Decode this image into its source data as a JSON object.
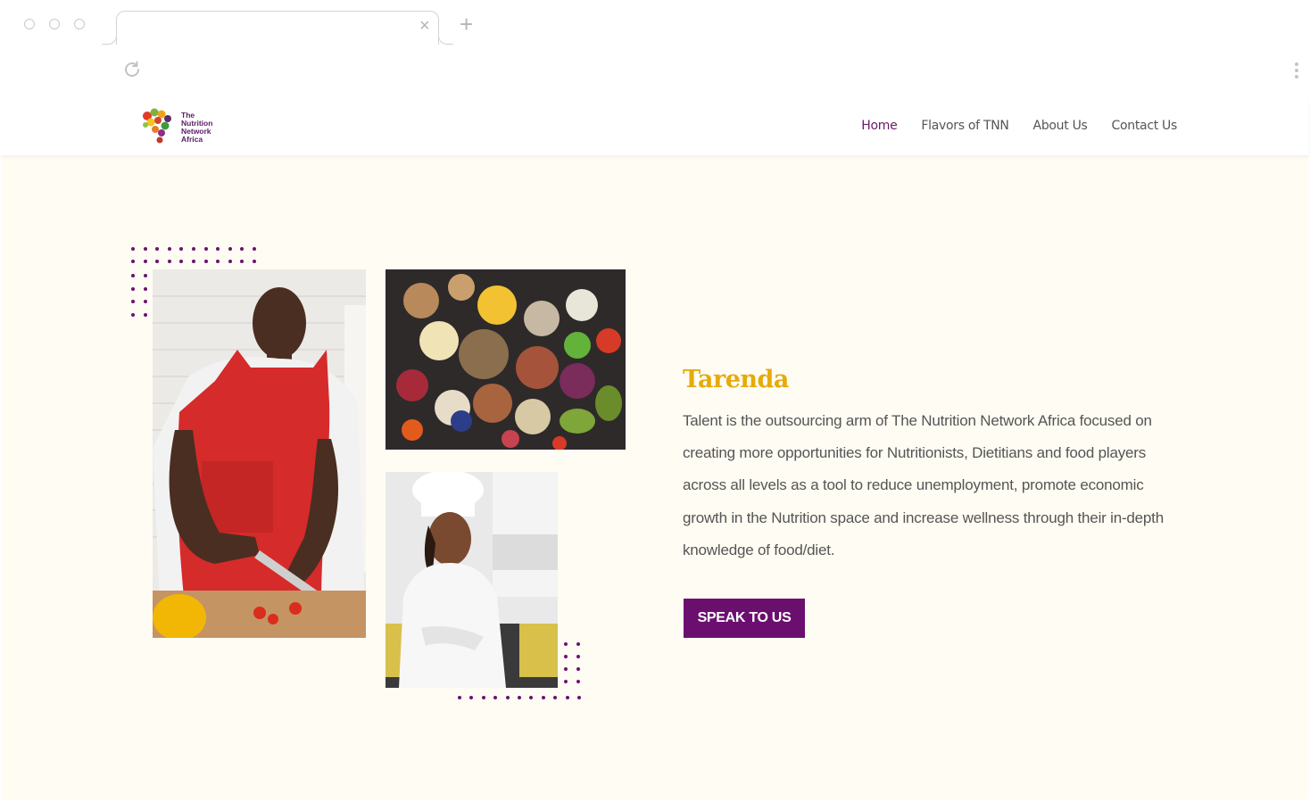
{
  "browser": {
    "tab_title": "",
    "close_glyph": "×",
    "new_tab_glyph": "+"
  },
  "site": {
    "logo_lines": [
      "The",
      "Nutrition",
      "Network",
      "Africa"
    ],
    "nav": [
      {
        "label": "Home",
        "active": true
      },
      {
        "label": "Flavors of TNN",
        "active": false
      },
      {
        "label": "About Us",
        "active": false
      },
      {
        "label": "Contact Us",
        "active": false
      }
    ]
  },
  "hero": {
    "title": "Tarenda",
    "body": "Talent is the outsourcing  arm of The Nutrition Network Africa focused on creating more opportunities for Nutritionists, Dietitians and food players across all levels as a tool to reduce unemployment, promote economic growth in the Nutrition space and increase wellness through their in-depth knowledge of food/diet.",
    "cta_label": "SPEAK TO US",
    "images": [
      {
        "name": "man-cooking-photo"
      },
      {
        "name": "vegetables-photo"
      },
      {
        "name": "chef-woman-photo"
      }
    ]
  },
  "colors": {
    "brand_purple": "#6b0f6e",
    "title_gold": "#e6aa0c",
    "hero_bg": "#fffcf3",
    "nav_active": "#6a1a6a"
  },
  "icons": [
    "reload-icon",
    "more-vertical-icon",
    "close-icon",
    "plus-icon"
  ]
}
